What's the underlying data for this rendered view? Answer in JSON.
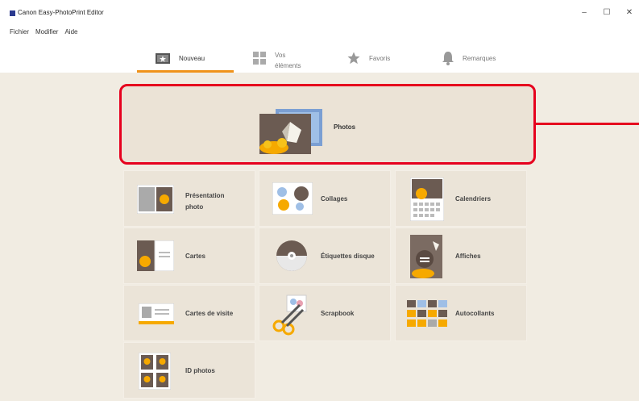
{
  "window": {
    "title": "Canon Easy-PhotoPrint Editor",
    "controls": {
      "minimize": "–",
      "maximize": "☐",
      "close": "✕"
    }
  },
  "menu": {
    "items": [
      "Fichier",
      "Modifier",
      "Aide"
    ]
  },
  "tabs": [
    {
      "label": "Nouveau",
      "icon": "new-icon",
      "active": true
    },
    {
      "label": "Vos\néléments",
      "icon": "grid-icon",
      "active": false
    },
    {
      "label": "Favoris",
      "icon": "star-icon",
      "active": false
    },
    {
      "label": "Remarques",
      "icon": "bell-icon",
      "active": false
    }
  ],
  "main": {
    "featured": {
      "label": "Photos",
      "icon": "photos-icon"
    },
    "categories": [
      {
        "label": "Présentation\nphoto",
        "icon": "photo-layout-icon"
      },
      {
        "label": "Collages",
        "icon": "collage-icon"
      },
      {
        "label": "Calendriers",
        "icon": "calendar-icon"
      },
      {
        "label": "Cartes",
        "icon": "card-icon"
      },
      {
        "label": "Étiquettes disque",
        "icon": "disc-label-icon"
      },
      {
        "label": "Affiches",
        "icon": "poster-icon"
      },
      {
        "label": "Cartes de visite",
        "icon": "business-card-icon"
      },
      {
        "label": "Scrapbook",
        "icon": "scrapbook-icon"
      },
      {
        "label": "Autocollants",
        "icon": "sticker-icon"
      },
      {
        "label": "ID photos",
        "icon": "id-photo-icon"
      }
    ]
  },
  "colors": {
    "accent": "#f0931a",
    "highlight": "#e6001e",
    "background": "#f1ece2",
    "card": "#ebe4d8"
  }
}
